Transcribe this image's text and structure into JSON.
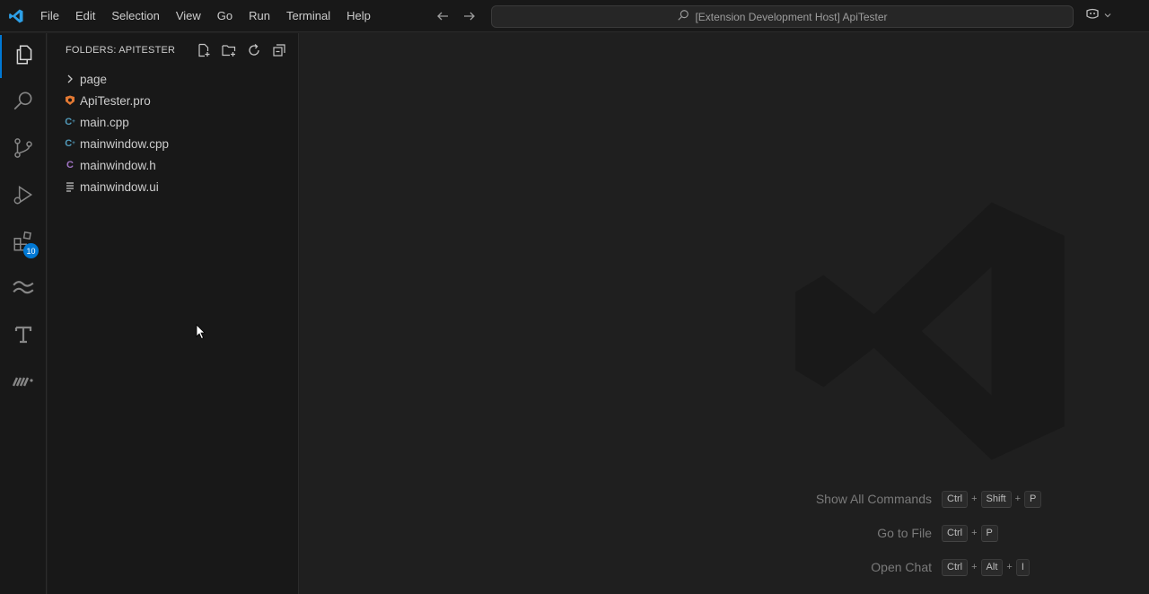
{
  "menu": [
    "File",
    "Edit",
    "Selection",
    "View",
    "Go",
    "Run",
    "Terminal",
    "Help"
  ],
  "command_center": {
    "text": "[Extension Development Host] ApiTester"
  },
  "activity": {
    "extensions_badge": "10"
  },
  "sidebar": {
    "header": "FOLDERS: APITESTER",
    "tree": [
      {
        "label": "page",
        "type": "folder"
      },
      {
        "label": "ApiTester.pro",
        "type": "pro"
      },
      {
        "label": "main.cpp",
        "type": "cpp"
      },
      {
        "label": "mainwindow.cpp",
        "type": "cpp"
      },
      {
        "label": "mainwindow.h",
        "type": "h"
      },
      {
        "label": "mainwindow.ui",
        "type": "ui"
      }
    ]
  },
  "shortcuts": [
    {
      "label": "Show All Commands",
      "keys": [
        "Ctrl",
        "Shift",
        "P"
      ]
    },
    {
      "label": "Go to File",
      "keys": [
        "Ctrl",
        "P"
      ]
    },
    {
      "label": "Open Chat",
      "keys": [
        "Ctrl",
        "Alt",
        "I"
      ]
    }
  ],
  "colors": {
    "accent": "#0078d4",
    "cpp_icon": "#519aba",
    "h_icon": "#a074c4",
    "pro_icon": "#e37933"
  }
}
